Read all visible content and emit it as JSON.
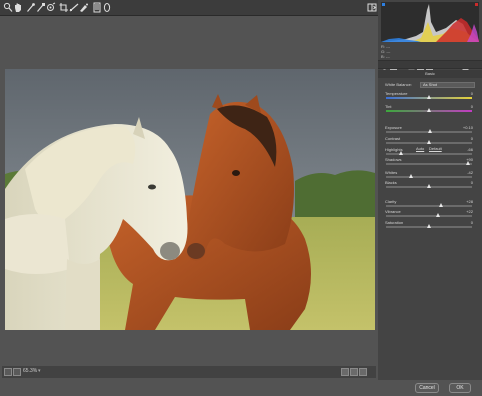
{
  "toolbar": {
    "tools": [
      "zoom-tool-icon",
      "hand-tool-icon",
      "white-balance-tool-icon",
      "color-sampler-tool-icon",
      "target-adjustment-tool-icon",
      "crop-tool-icon",
      "straighten-tool-icon",
      "spot-removal-tool-icon",
      "red-eye-tool-icon",
      "adjustment-brush-icon",
      "radial-filter-icon"
    ],
    "right_icon": "open-preferences-icon"
  },
  "histogram": {
    "readout_r": "R:  ---",
    "readout_g": "G:  ---",
    "readout_b": "B:  ---"
  },
  "panel": {
    "section_title": "Basic",
    "white_balance_label": "White Balance:",
    "white_balance_value": "As Shot",
    "auto_label": "Auto",
    "default_label": "Default",
    "sliders": [
      {
        "label": "Temperature",
        "value": "0",
        "pos": 0.5
      },
      {
        "label": "Tint",
        "value": "0",
        "pos": 0.5
      },
      {
        "label": "Exposure",
        "value": "+0.10",
        "pos": 0.51
      },
      {
        "label": "Contrast",
        "value": "0",
        "pos": 0.5
      },
      {
        "label": "Highlights",
        "value": "-66",
        "pos": 0.17
      },
      {
        "label": "Shadows",
        "value": "+90",
        "pos": 0.95
      },
      {
        "label": "Whites",
        "value": "-42",
        "pos": 0.29
      },
      {
        "label": "Blacks",
        "value": "0",
        "pos": 0.5
      },
      {
        "label": "Clarity",
        "value": "+28",
        "pos": 0.64
      },
      {
        "label": "Vibrance",
        "value": "+22",
        "pos": 0.61
      },
      {
        "label": "Saturation",
        "value": "0",
        "pos": 0.5
      }
    ]
  },
  "status": {
    "zoom": "65.3%"
  },
  "footer": {
    "cancel_label": "Cancel",
    "ok_label": "OK"
  },
  "colors": {
    "background": "#535353",
    "panel": "#444444",
    "toolbar": "#3c3c3c"
  }
}
